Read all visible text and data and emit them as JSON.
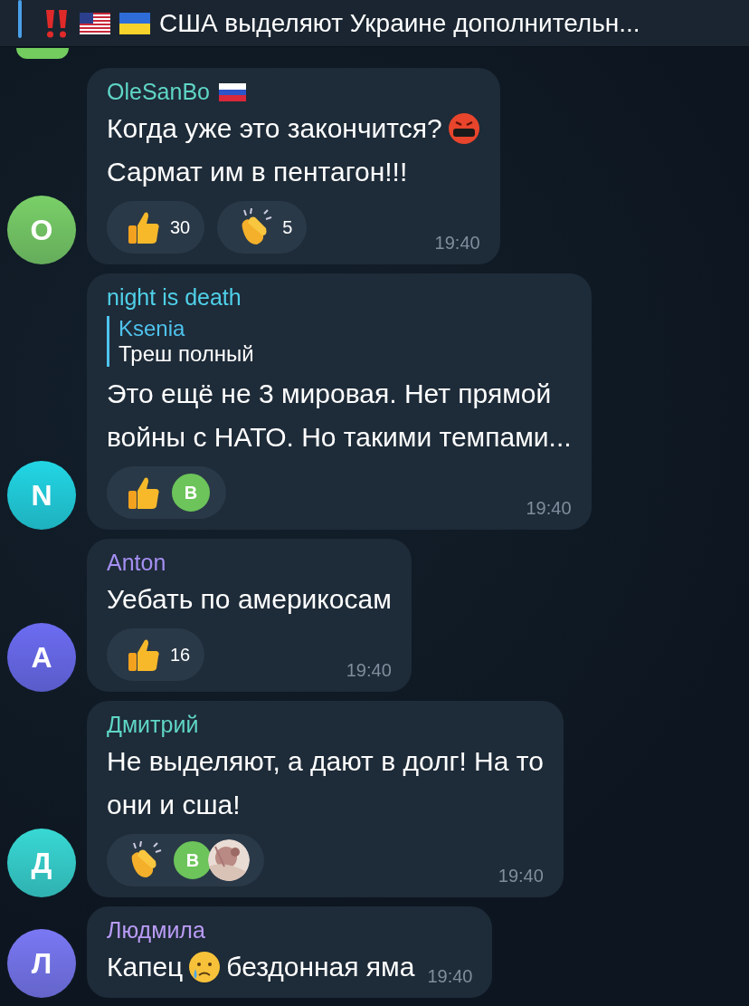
{
  "pinned": {
    "icons": [
      {
        "kind": "exclamation"
      },
      {
        "kind": "usa"
      },
      {
        "kind": "ukraine"
      }
    ],
    "text": "США выделяют Украине дополнительн..."
  },
  "top_avatar": {
    "color": "#72cc5e"
  },
  "messages": [
    {
      "author": {
        "name": "OleSanBo",
        "color": "#5fd6c6",
        "badges": [
          {
            "kind": "russia"
          }
        ]
      },
      "avatar": {
        "letter": "O",
        "color": "#7ad068"
      },
      "lines": [
        [
          {
            "kind": "text",
            "text": "Когда уже это закончится?"
          },
          {
            "kind": "angry"
          }
        ],
        [
          {
            "kind": "text",
            "text": "Сармат им в пентагон!!!"
          }
        ]
      ],
      "reactions": [
        {
          "kind": "thumbs",
          "count": "30"
        },
        {
          "kind": "clap",
          "count": "5"
        }
      ],
      "time": "19:40"
    },
    {
      "author": {
        "name": "night is death",
        "color": "#4fd0e8"
      },
      "avatar": {
        "letter": "N",
        "color": "#22d6e4"
      },
      "reply": {
        "author": "Ksenia",
        "text": "Треш полный"
      },
      "lines": [
        [
          {
            "kind": "text",
            "text": "Это ещё не 3 мировая. Нет прямой"
          }
        ],
        [
          {
            "kind": "text",
            "text": "войны с НАТО.  Но такими темпами..."
          }
        ]
      ],
      "reactions": [
        {
          "kind": "thumbs",
          "avatars": [
            {
              "kind": "letter",
              "letter": "В",
              "color": "#6cc45a"
            }
          ]
        }
      ],
      "time": "19:40"
    },
    {
      "author": {
        "name": "Anton",
        "color": "#a48ff2"
      },
      "avatar": {
        "letter": "A",
        "color": "#6c6cf2"
      },
      "lines": [
        [
          {
            "kind": "text",
            "text": "Уебать по америкосам"
          }
        ]
      ],
      "reactions": [
        {
          "kind": "thumbs",
          "count": "16"
        }
      ],
      "time": "19:40"
    },
    {
      "author": {
        "name": "Дмитрий",
        "color": "#5fd6c6"
      },
      "avatar": {
        "letter": "Д",
        "color": "#38d8d4"
      },
      "lines": [
        [
          {
            "kind": "text",
            "text": "Не выделяют, а дают в долг! На то"
          }
        ],
        [
          {
            "kind": "text",
            "text": "они и сша!"
          }
        ]
      ],
      "reactions": [
        {
          "kind": "clap",
          "avatars": [
            {
              "kind": "letter",
              "letter": "В",
              "color": "#6cc45a"
            },
            {
              "kind": "picture"
            }
          ]
        }
      ],
      "time": "19:40"
    },
    {
      "author": {
        "name": "Людмила",
        "color": "#b99cf6"
      },
      "avatar": {
        "letter": "Л",
        "color": "#7a78f4"
      },
      "lines": [
        [
          {
            "kind": "text",
            "text": "Капец"
          },
          {
            "kind": "crying"
          },
          {
            "kind": "text",
            "text": "бездонная яма"
          }
        ]
      ],
      "time": "19:40"
    }
  ]
}
